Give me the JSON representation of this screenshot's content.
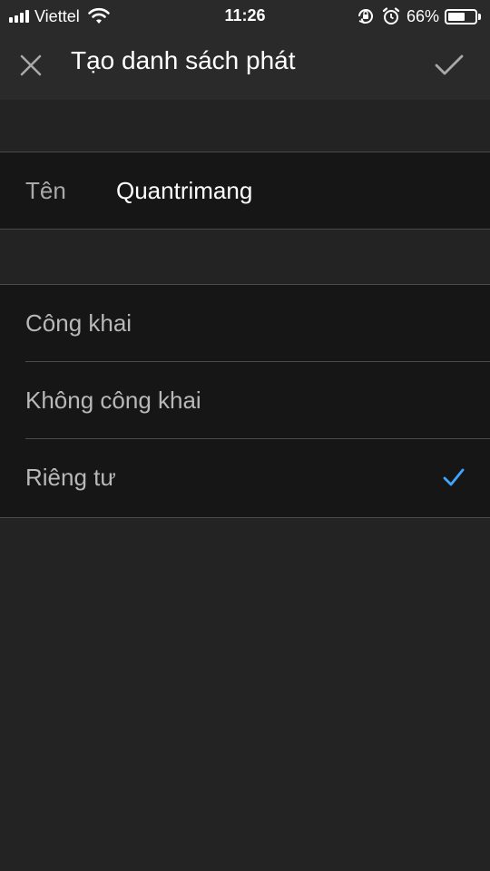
{
  "status_bar": {
    "carrier": "Viettel",
    "time": "11:26",
    "battery_percent": "66%",
    "battery_level": 0.66,
    "icons": [
      "signal-icon",
      "wifi-icon",
      "orientation-lock-icon",
      "alarm-icon",
      "battery-icon"
    ]
  },
  "header": {
    "title": "Tạo danh sách phát",
    "close_icon": "close-icon",
    "confirm_icon": "checkmark-icon"
  },
  "name_field": {
    "label": "Tên",
    "value": "Quantrimang"
  },
  "privacy_options": [
    {
      "label": "Công khai",
      "selected": false
    },
    {
      "label": "Không công khai",
      "selected": false
    },
    {
      "label": "Riêng tư",
      "selected": true
    }
  ],
  "colors": {
    "background": "#232323",
    "header_background": "#2a2a2a",
    "row_background": "#161616",
    "accent": "#3ea6ff"
  }
}
